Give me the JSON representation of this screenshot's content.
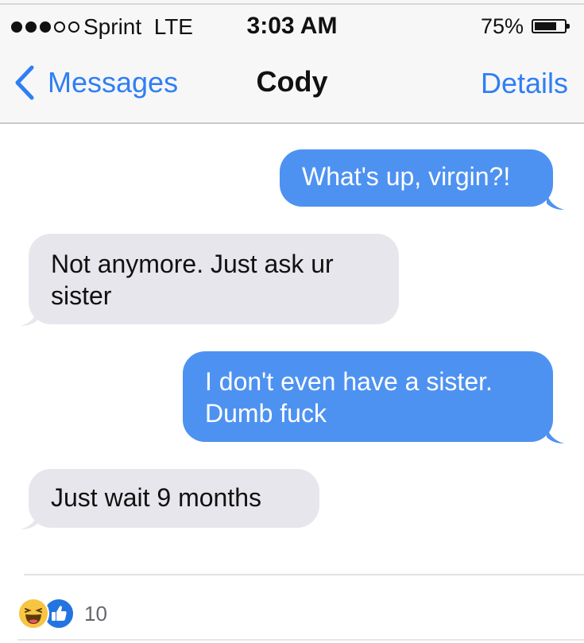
{
  "status_bar": {
    "signal_dots_filled": 3,
    "signal_dots_total": 5,
    "carrier": "Sprint  LTE",
    "time": "3:03 AM",
    "battery_percent_label": "75%",
    "battery_level": 0.75
  },
  "nav": {
    "back_label": "Messages",
    "title": "Cody",
    "details_label": "Details"
  },
  "messages": [
    {
      "direction": "outgoing",
      "text": "What's up, virgin?!"
    },
    {
      "direction": "incoming",
      "text": "Not anymore. Just ask ur sister"
    },
    {
      "direction": "outgoing",
      "text": "I don't even have a sister. Dumb fuck"
    },
    {
      "direction": "incoming",
      "text": "Just wait 9 months"
    }
  ],
  "reactions": {
    "icons": [
      "haha-emoji-icon",
      "like-icon"
    ],
    "count": "10"
  },
  "colors": {
    "outgoing_bubble": "#4e92f1",
    "incoming_bubble": "#e7e6ec",
    "ios_blue": "#2f7ff3",
    "facebook_like_blue": "#2374e1"
  }
}
